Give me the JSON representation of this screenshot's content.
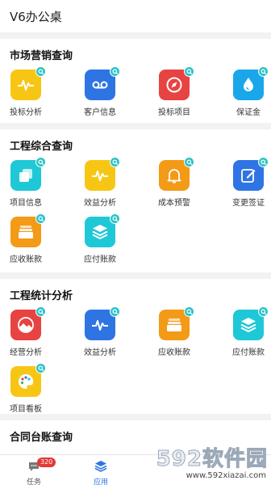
{
  "header": {
    "title": "V6办公桌"
  },
  "sections": [
    {
      "title": "市场营销查询",
      "items": [
        {
          "label": "投标分析",
          "color": "#f7c615",
          "icon": "pulse-icon"
        },
        {
          "label": "客户信息",
          "color": "#2f74e3",
          "icon": "voicemail-icon"
        },
        {
          "label": "投标项目",
          "color": "#e84343",
          "icon": "compass-icon"
        },
        {
          "label": "保证金",
          "color": "#1aa7ea",
          "icon": "drop-icon"
        }
      ]
    },
    {
      "title": "工程综合查询",
      "items": [
        {
          "label": "项目信息",
          "color": "#1ec8d6",
          "icon": "copy-icon"
        },
        {
          "label": "效益分析",
          "color": "#f7c615",
          "icon": "pulse-icon"
        },
        {
          "label": "成本预警",
          "color": "#f39a17",
          "icon": "bell-icon"
        },
        {
          "label": "变更签证",
          "color": "#2f74e3",
          "icon": "edit-icon"
        },
        {
          "label": "应收账款",
          "color": "#f39a17",
          "icon": "folder-icon"
        },
        {
          "label": "应付账款",
          "color": "#1ec8d6",
          "icon": "layers-icon"
        }
      ]
    },
    {
      "title": "工程统计分析",
      "items": [
        {
          "label": "经营分析",
          "color": "#e84343",
          "icon": "landscape-icon"
        },
        {
          "label": "效益分析",
          "color": "#2f74e3",
          "icon": "pulse-icon"
        },
        {
          "label": "应收账款",
          "color": "#f39a17",
          "icon": "folder-icon"
        },
        {
          "label": "应付账款",
          "color": "#1ec8d6",
          "icon": "layers-icon"
        },
        {
          "label": "项目看板",
          "color": "#f7c615",
          "icon": "palette-icon"
        }
      ]
    },
    {
      "title": "合同台账查询",
      "items": []
    }
  ],
  "tabbar": {
    "tasks": {
      "label": "任务",
      "badge": "320",
      "color": "#555555"
    },
    "apps": {
      "label": "应用",
      "color": "#2f74e3"
    }
  },
  "watermark": {
    "brand": "592软件园",
    "url": "www.592xiazai.com"
  }
}
